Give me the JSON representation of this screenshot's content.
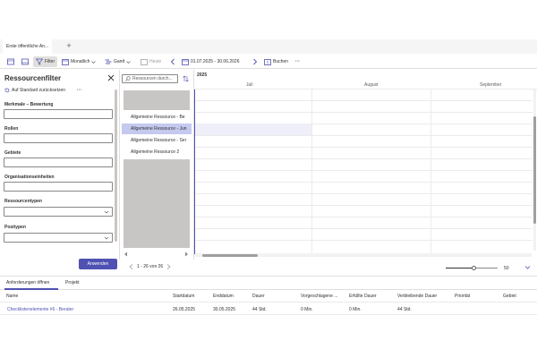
{
  "tabs": {
    "active": "Erste öffentliche An...",
    "add_symbol": "+"
  },
  "toolbar": {
    "filter_label": "Filter",
    "view_label": "Monatlich",
    "gantt_label": "Gantt",
    "today_label": "Heute",
    "date_range": "01.07.2025 - 30.06.2026",
    "book_label": "Buchen",
    "more_label": "···"
  },
  "filter_panel": {
    "title": "Ressourcenfilter",
    "reset_label": "Auf Standard zurücksetzen",
    "more_label": "···",
    "fields": [
      {
        "label": "Merkmale – Bewertung",
        "type": "text"
      },
      {
        "label": "Rollen",
        "type": "text"
      },
      {
        "label": "Gebiete",
        "type": "text"
      },
      {
        "label": "Organisationseinheiten",
        "type": "text"
      },
      {
        "label": "Ressourcentypen",
        "type": "select"
      },
      {
        "label": "Positypen",
        "type": "select"
      }
    ],
    "apply_label": "Anwenden"
  },
  "resources": {
    "search_placeholder": "Ressourcen durch...",
    "items": [
      {
        "label": "Allgemeine Ressource - Be",
        "selected": false
      },
      {
        "label": "Allgemeine Ressource - Jun",
        "selected": true
      },
      {
        "label": "Allgemeine Ressource - Ser",
        "selected": false
      },
      {
        "label": "Allgemeine Ressource 2",
        "selected": false
      }
    ],
    "pager": "1 - 26 von 26"
  },
  "gantt": {
    "year": "2025",
    "months": [
      "Juli",
      "August",
      "September"
    ],
    "zoom_value": "50",
    "zoom_level": 0.55
  },
  "bottom": {
    "tabs": [
      "Anforderungen öffnen",
      "Projekt"
    ],
    "columns": [
      "Name",
      "Startdatum",
      "Enddatum",
      "Dauer",
      "Vorgeschlagene ...",
      "Erfüllte Dauer",
      "Verbleibende Dauer",
      "Priorität",
      "Gebiet"
    ],
    "rows": [
      [
        "Checklistenelemente #6 - Berater",
        "26.05.2025",
        "30.05.2025",
        "44 Std.",
        "0 Min.",
        "0 Min.",
        "44 Std.",
        "",
        ""
      ]
    ]
  },
  "colors": {
    "accent": "#4f52b2",
    "selected_row": "#c5c9ef"
  }
}
